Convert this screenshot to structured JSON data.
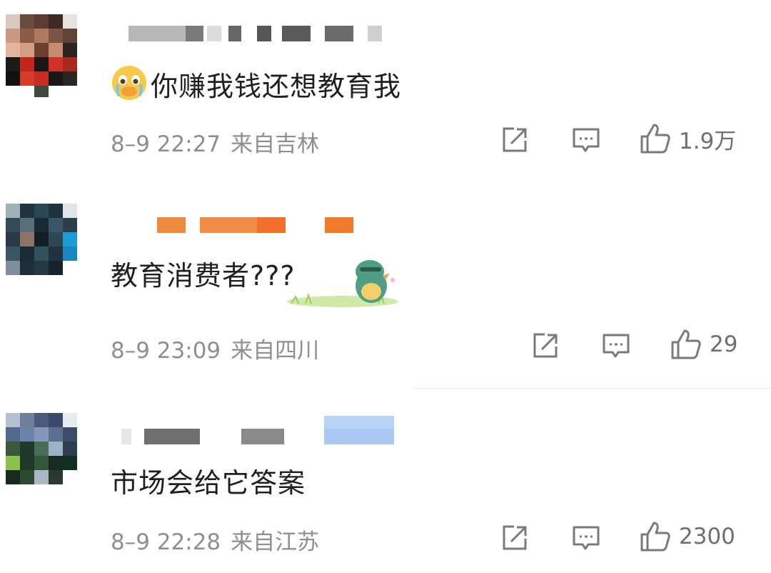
{
  "comments": [
    {
      "text": "你赚我钱还想教育我",
      "emoji": "crying-face-icon",
      "time": "8–9 22:27",
      "location": "来自吉林",
      "likes": "1.9万"
    },
    {
      "text": "教育消费者???",
      "sticker": "dinosaur-sticker",
      "time": "8–9 23:09",
      "location": "来自四川",
      "likes": "29"
    },
    {
      "text": "市场会给它答案",
      "time": "8–9 22:28",
      "location": "来自江苏",
      "likes": "2300"
    }
  ],
  "icons": {
    "share": "share-icon",
    "reply": "comment-icon",
    "like": "thumbs-up-icon"
  },
  "colors": {
    "text": "#1f1f1f",
    "meta": "#8f8f8f",
    "icon": "#7a7a7a"
  }
}
